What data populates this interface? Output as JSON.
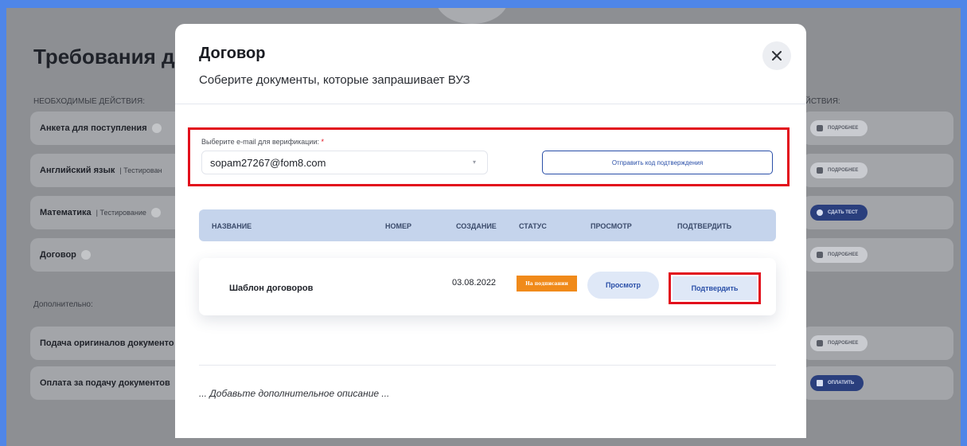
{
  "background": {
    "page_title": "Требования дл",
    "required_header": "НЕОБХОДИМЫЕ ДЕЙСТВИЯ:",
    "actions_header": "ЕЙСТВИЯ:",
    "items": [
      {
        "title": "Анкета для поступления",
        "sub": ""
      },
      {
        "title": "Английский язык",
        "sub": "| Тестирован"
      },
      {
        "title": "Математика",
        "sub": "| Тестирование"
      },
      {
        "title": "Договор",
        "sub": ""
      }
    ],
    "additional_header": "Дополнительно:",
    "additional_items": [
      {
        "title": "Подача оригиналов документо"
      },
      {
        "title": "Оплата за подачу документов"
      }
    ],
    "buttons": {
      "details": "ПОДРОБНЕЕ",
      "take_test": "СДАТЬ ТЕСТ",
      "pay": "ОПЛАТИТЬ"
    }
  },
  "modal": {
    "title": "Договор",
    "subtitle": "Соберите документы, которые запрашивает ВУЗ",
    "close_icon": "close-icon",
    "email_label": "Выберите e-mail для верификации:",
    "required_mark": "*",
    "email_value": "sopam27267@fom8.com",
    "send_code_label": "Отправить код подтверждения",
    "columns": [
      "НАЗВАНИЕ",
      "НОМЕР",
      "СОЗДАНИЕ",
      "СТАТУС",
      "ПРОСМОТР",
      "ПОДТВЕРДИТЬ"
    ],
    "row": {
      "name": "Шаблон договоров",
      "number": "",
      "date": "03.08.2022",
      "status": "На подписании",
      "view_label": "Просмотр",
      "confirm_label": "Подтвердить"
    },
    "description_placeholder": "... Добавьте дополнительное описание ..."
  },
  "colors": {
    "accent": "#2a4fa8",
    "highlight": "#e20f1c",
    "status": "#f08a1a",
    "table_header": "#c5d4ec"
  }
}
